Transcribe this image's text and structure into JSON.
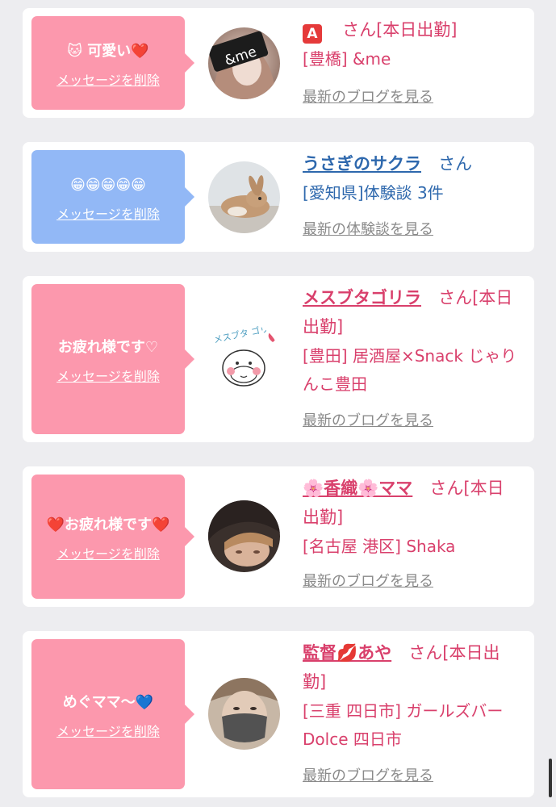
{
  "cards": [
    {
      "message": "🐱 可愛い❤️",
      "delete_label": "メッセージを削除",
      "bubble_color": "#fc98ad",
      "avatar": "photo-me-avatar",
      "name": "🅰️",
      "san": "さん[本日出勤]",
      "details": "[豊橋] &me",
      "more": "最新のブログを見る"
    },
    {
      "message": "😁😁😁😁😁",
      "delete_label": "メッセージを削除",
      "bubble_color": "#92b8f6",
      "avatar": "rabbit-avatar",
      "name": "うさぎのサクラ",
      "san": "さん",
      "details": "[愛知県]体験談 3件",
      "more": "最新の体験談を見る"
    },
    {
      "message": "お疲れ様です♡",
      "delete_label": "メッセージを削除",
      "bubble_color": "#fc98ad",
      "avatar": "gorilla-drawing-avatar",
      "avatar_text": "メスブタ ゴリラ",
      "name": "メスブタゴリラ",
      "san": "さん[本日出勤]",
      "details": "[豊田] 居酒屋×Snack じゃりんこ豊田",
      "more": "最新のブログを見る"
    },
    {
      "message": "❤️お疲れ様です❤️",
      "delete_label": "メッセージを削除",
      "bubble_color": "#fc98ad",
      "avatar": "photo-woman-avatar",
      "name": "🌸香織🌸ママ",
      "san": "さん[本日出勤]",
      "details": "[名古屋 港区] Shaka",
      "more": "最新のブログを見る"
    },
    {
      "message": "めぐママ〜💙",
      "delete_label": "メッセージを削除",
      "bubble_color": "#fc98ad",
      "avatar": "photo-mask-avatar",
      "name": "監督💋あや",
      "san": "さん[本日出勤]",
      "details": "[三重 四日市] ガールズバー Dolce 四日市",
      "more": "最新のブログを見る"
    }
  ],
  "photo_me_text": "&me"
}
